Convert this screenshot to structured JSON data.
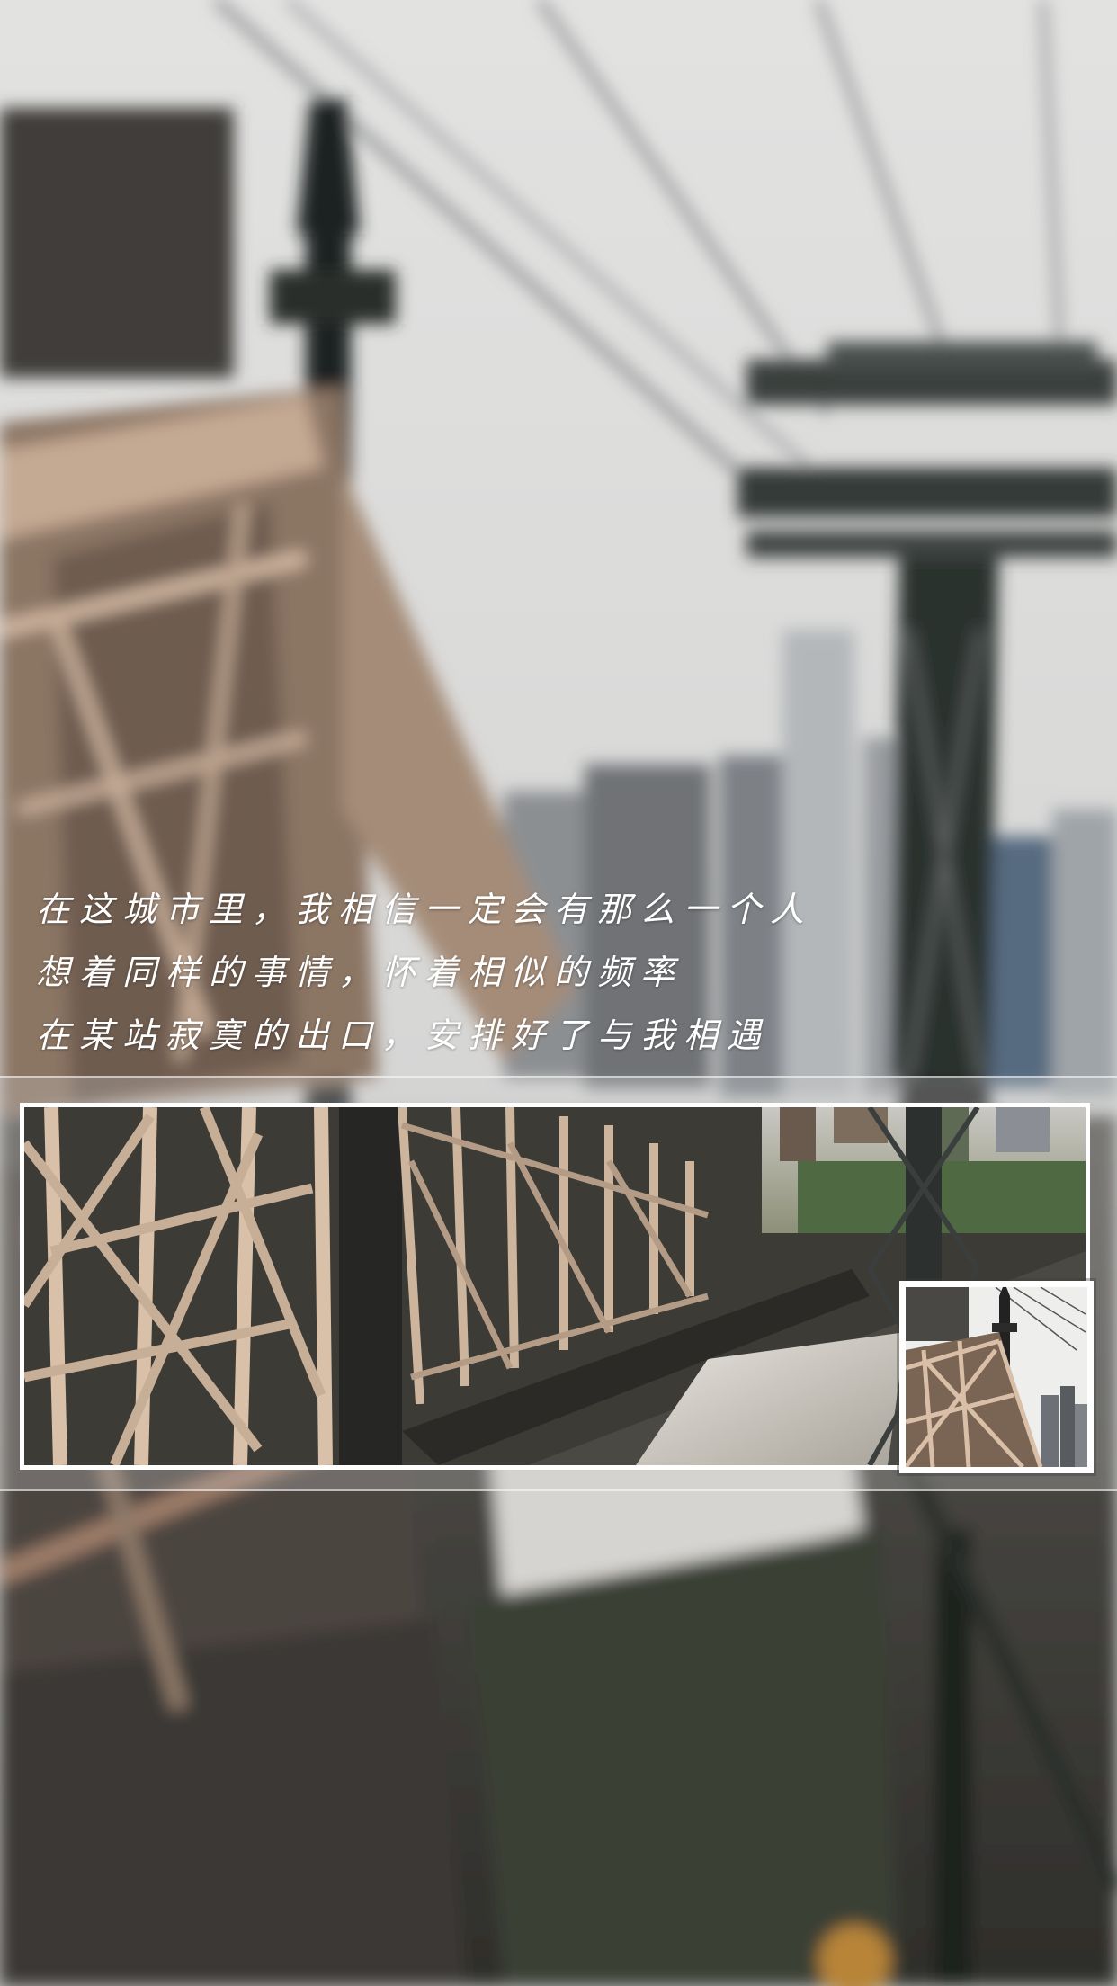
{
  "poem": {
    "lines": [
      "在这城市里，我相信一定会有那么一个人",
      "想着同样的事情，怀着相似的频率",
      "在某站寂寞的出口，安排好了与我相遇"
    ]
  },
  "colors": {
    "text": "#ffffff",
    "sky": "#d9d9d8",
    "bridge_steel": "#b49a85",
    "tower_dark": "#2f3433",
    "frame": "#ffffff"
  },
  "images": {
    "background": "blurred-bridge-cable-tower-scene",
    "main_photo": "bridge-truss-close-up",
    "thumbnail": "bridge-tower-with-sky"
  }
}
